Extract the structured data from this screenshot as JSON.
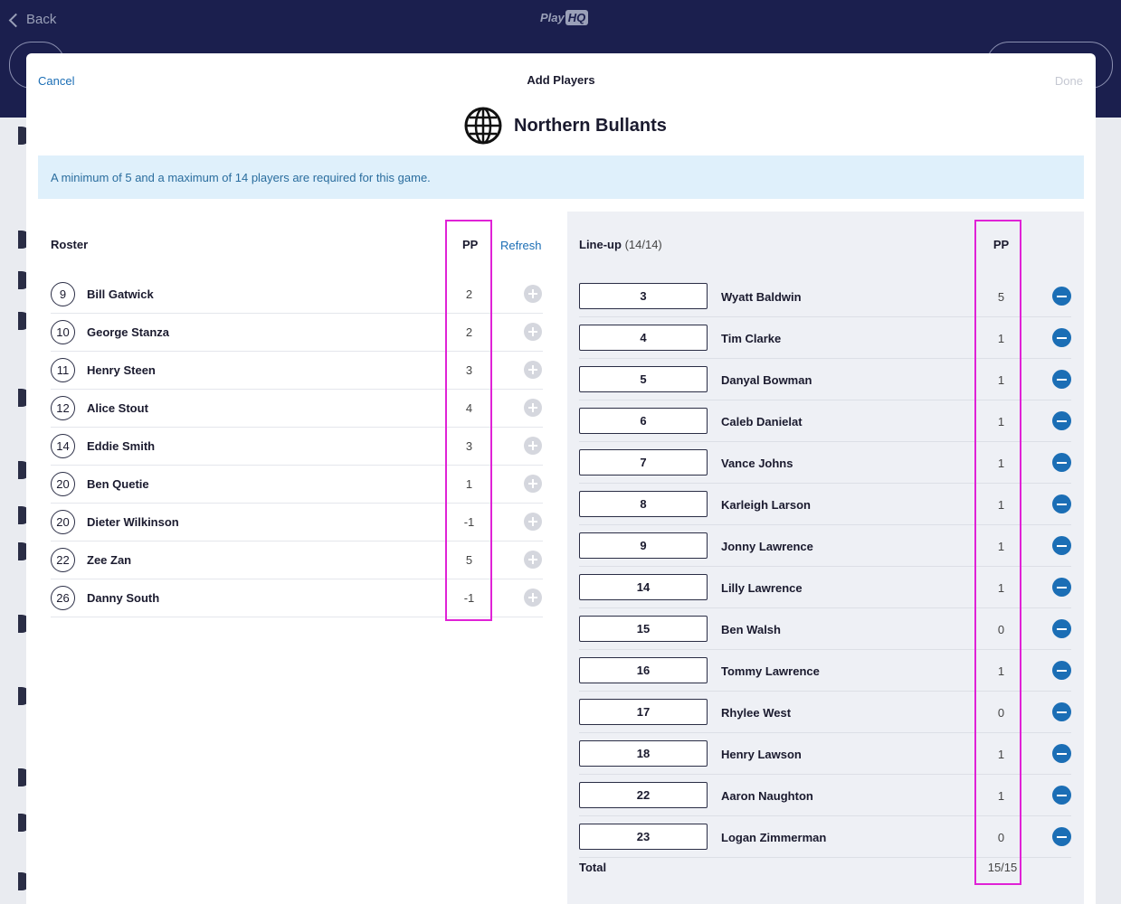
{
  "background": {
    "back_label": "Back",
    "logo_text": "Play",
    "logo_badge": "HQ"
  },
  "modal": {
    "cancel_label": "Cancel",
    "title": "Add Players",
    "done_label": "Done",
    "team_name": "Northern Bullants",
    "notice": "A minimum of 5 and a maximum of 14 players are required for this game."
  },
  "roster": {
    "heading": "Roster",
    "pp_heading": "PP",
    "refresh_label": "Refresh",
    "players": [
      {
        "number": "9",
        "name": "Bill Gatwick",
        "pp": "2"
      },
      {
        "number": "10",
        "name": "George Stanza",
        "pp": "2"
      },
      {
        "number": "11",
        "name": "Henry Steen",
        "pp": "3"
      },
      {
        "number": "12",
        "name": "Alice Stout",
        "pp": "4"
      },
      {
        "number": "14",
        "name": "Eddie Smith",
        "pp": "3"
      },
      {
        "number": "20",
        "name": "Ben Quetie",
        "pp": "1"
      },
      {
        "number": "20",
        "name": "Dieter Wilkinson",
        "pp": "-1"
      },
      {
        "number": "22",
        "name": "Zee Zan",
        "pp": "5"
      },
      {
        "number": "26",
        "name": "Danny South",
        "pp": "-1"
      }
    ]
  },
  "lineup": {
    "heading": "Line-up",
    "count": "(14/14)",
    "pp_heading": "PP",
    "total_label": "Total",
    "total_value": "15/15",
    "players": [
      {
        "number": "3",
        "name": "Wyatt Baldwin",
        "pp": "5"
      },
      {
        "number": "4",
        "name": "Tim Clarke",
        "pp": "1"
      },
      {
        "number": "5",
        "name": "Danyal Bowman",
        "pp": "1"
      },
      {
        "number": "6",
        "name": "Caleb Danielat",
        "pp": "1"
      },
      {
        "number": "7",
        "name": "Vance Johns",
        "pp": "1"
      },
      {
        "number": "8",
        "name": "Karleigh Larson",
        "pp": "1"
      },
      {
        "number": "9",
        "name": "Jonny Lawrence",
        "pp": "1"
      },
      {
        "number": "14",
        "name": "Lilly Lawrence",
        "pp": "1"
      },
      {
        "number": "15",
        "name": "Ben Walsh",
        "pp": "0"
      },
      {
        "number": "16",
        "name": "Tommy Lawrence",
        "pp": "1"
      },
      {
        "number": "17",
        "name": "Rhylee West",
        "pp": "0"
      },
      {
        "number": "18",
        "name": "Henry Lawson",
        "pp": "1"
      },
      {
        "number": "22",
        "name": "Aaron Naughton",
        "pp": "1"
      },
      {
        "number": "23",
        "name": "Logan Zimmerman",
        "pp": "0"
      }
    ]
  },
  "colors": {
    "accent": "#1b6eb5",
    "highlight": "#e022d6",
    "notice_bg": "#dff0fb",
    "header_bg": "#1b1f4e"
  },
  "icons": {
    "team_logo": "globe-icon",
    "add": "plus-circle-icon",
    "remove": "minus-circle-icon"
  }
}
